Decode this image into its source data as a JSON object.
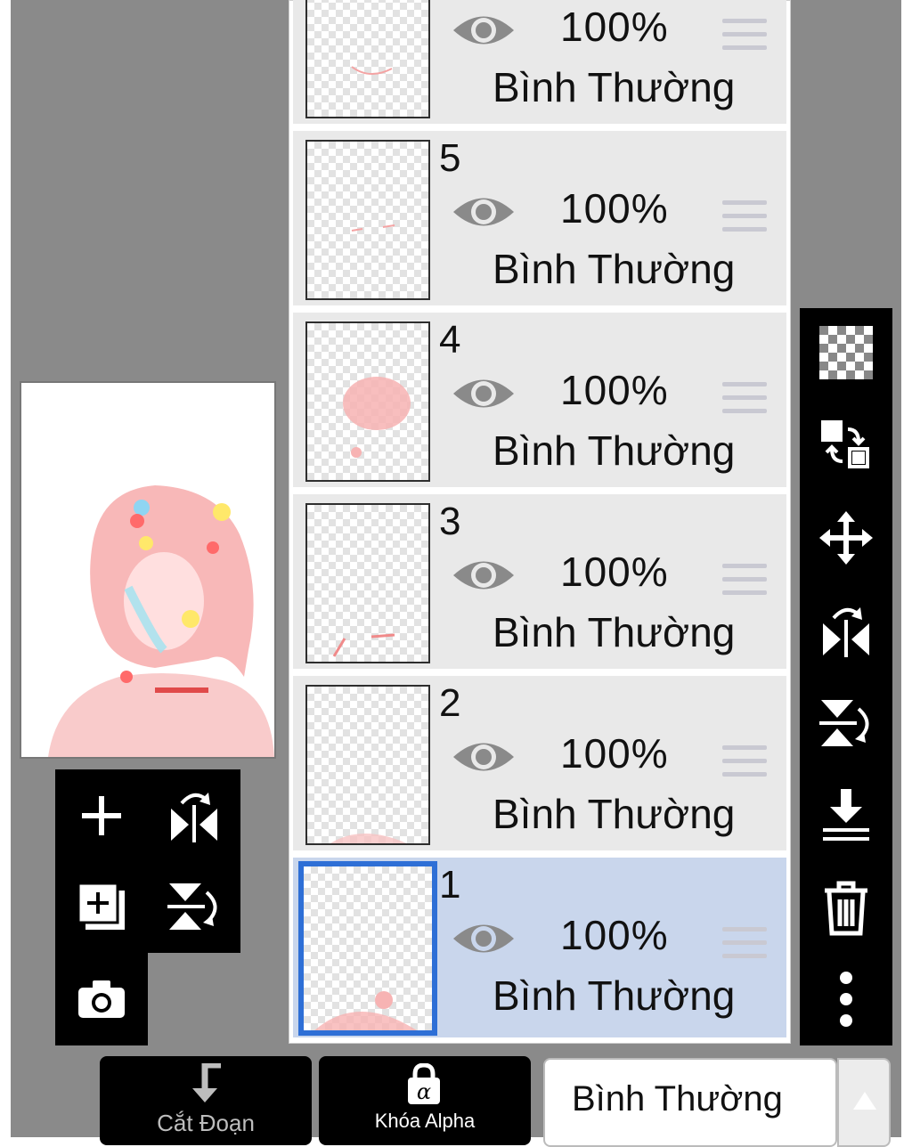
{
  "layers": [
    {
      "number": "",
      "opacity": "100%",
      "blend": "Bình Thường",
      "selected": false
    },
    {
      "number": "5",
      "opacity": "100%",
      "blend": "Bình Thường",
      "selected": false
    },
    {
      "number": "4",
      "opacity": "100%",
      "blend": "Bình Thường",
      "selected": false
    },
    {
      "number": "3",
      "opacity": "100%",
      "blend": "Bình Thường",
      "selected": false
    },
    {
      "number": "2",
      "opacity": "100%",
      "blend": "Bình Thường",
      "selected": false
    },
    {
      "number": "1",
      "opacity": "100%",
      "blend": "Bình Thường",
      "selected": true
    }
  ],
  "right_toolbar": [
    "transparency-checker-icon",
    "swap-layers-icon",
    "move-icon",
    "flip-horizontal-icon",
    "flip-vertical-icon",
    "merge-down-icon",
    "trash-icon",
    "more-vertical-icon"
  ],
  "left_toolbar": [
    "add-layer-icon",
    "flip-canvas-horizontal-icon",
    "add-copy-layer-icon",
    "flip-canvas-vertical-icon",
    "camera-icon"
  ],
  "bottom": {
    "clipping_label": "Cắt Đoạn",
    "alpha_lock_label": "Khóa Alpha",
    "blend_mode_value": "Bình Thường"
  },
  "colors": {
    "selected_layer": "#c9d6ec",
    "selected_border": "#2e6fd6",
    "layer_bg": "#e9e9e9",
    "toolbar": "#000000",
    "artwork_pink": "#f5a3a3"
  }
}
